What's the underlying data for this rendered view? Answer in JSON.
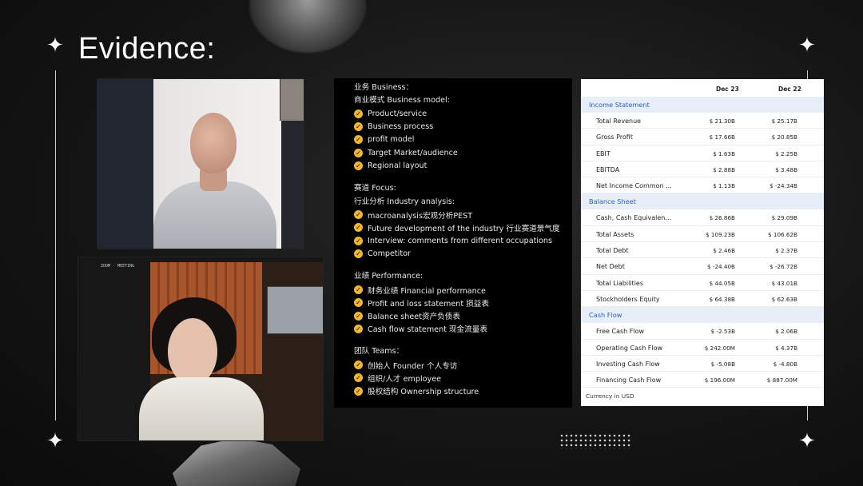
{
  "title": "Evidence:",
  "video1": {
    "kind": "video-call-tile"
  },
  "video2": {
    "kind": "video-call-tile",
    "corner_label": "ZOOM · MEETING"
  },
  "checklist": {
    "business": {
      "heading": "业务 Business：",
      "subheading": "商业模式 Business model:",
      "items": [
        "Product/service",
        "Business process",
        "profit model",
        "Target Market/audience",
        "Regional layout"
      ]
    },
    "focus": {
      "heading": "赛道 Focus:",
      "subheading": "行业分析 Industry analysis:",
      "items": [
        "macroanalysis宏观分析PEST",
        "Future development of the industry 行业赛道景气度",
        "Interview: comments from different occupations",
        "Competitor"
      ]
    },
    "performance": {
      "heading": "业绩 Performance:",
      "items": [
        "财务业绩 Financial performance",
        "Profit and loss statement 损益表",
        "Balance sheet资产负债表",
        "Cash flow statement 现金流量表"
      ]
    },
    "teams": {
      "heading": "团队 Teams：",
      "items": [
        "创始人 Founder 个人专访",
        "组织/人才 employee",
        "股权结构 Ownership structure"
      ]
    }
  },
  "financials": {
    "col1": "Dec 23",
    "col2": "Dec 22",
    "income": {
      "label": "Income Statement",
      "rows": [
        [
          "Total Revenue",
          "$ 21.30B",
          "$ 25.17B"
        ],
        [
          "Gross Profit",
          "$ 17.66B",
          "$ 20.85B"
        ],
        [
          "EBIT",
          "$ 1.63B",
          "$ 2.25B"
        ],
        [
          "EBITDA",
          "$ 2.88B",
          "$ 3.48B"
        ],
        [
          "Net Income Common ...",
          "$ 1.13B",
          "$ -24.34B"
        ]
      ]
    },
    "balance": {
      "label": "Balance Sheet",
      "rows": [
        [
          "Cash, Cash Equivalent...",
          "$ 26.86B",
          "$ 29.09B"
        ],
        [
          "Total Assets",
          "$ 109.23B",
          "$ 106.62B"
        ],
        [
          "Total Debt",
          "$ 2.46B",
          "$ 2.37B"
        ],
        [
          "Net Debt",
          "$ -24.40B",
          "$ -26.72B"
        ],
        [
          "Total Liabilities",
          "$ 44.05B",
          "$ 43.01B"
        ],
        [
          "Stockholders Equity",
          "$ 64.38B",
          "$ 62.63B"
        ]
      ]
    },
    "cashflow": {
      "label": "Cash Flow",
      "rows": [
        [
          "Free Cash Flow",
          "$ -2.53B",
          "$ 2.06B"
        ],
        [
          "Operating Cash Flow",
          "$ 242.00M",
          "$ 4.37B"
        ],
        [
          "Investing Cash Flow",
          "$ -5.08B",
          "$ -4.80B"
        ],
        [
          "Financing Cash Flow",
          "$ 196.00M",
          "$ 887.00M"
        ]
      ]
    },
    "footer": "Currency in USD"
  }
}
